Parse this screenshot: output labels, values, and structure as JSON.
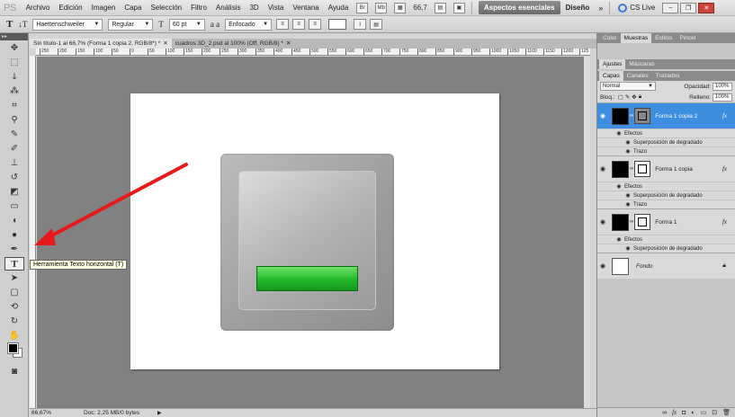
{
  "menubar": {
    "logo": "PS",
    "items": [
      "Archivo",
      "Edición",
      "Imagen",
      "Capa",
      "Selección",
      "Filtro",
      "Análisis",
      "3D",
      "Vista",
      "Ventana",
      "Ayuda"
    ],
    "br_label": "Br",
    "mb_label": "Mb",
    "zoom": "66,7",
    "workspace_active": "Aspectos esenciales",
    "workspace_design": "Diseño",
    "more": "»",
    "cslive": "CS Live"
  },
  "options": {
    "tool_glyph": "T",
    "orient_glyph": "↓T",
    "font_family": "Haettenschweiler",
    "font_style": "Regular",
    "size_glyph": "T",
    "font_size": "60 pt",
    "aa_glyph": "a a",
    "antialias": "Enfocado"
  },
  "tooltip": "Herramienta Texto horizontal (T)",
  "doc_tabs": [
    {
      "label": "Sin título-1 al 66,7% (Forma 1 copia 2, RGB/8*) *",
      "active": true
    },
    {
      "label": "cuadros 3D_2.psd al 100% (Off, RGB/8) *",
      "active": false
    }
  ],
  "ruler_ticks": [
    "250",
    "200",
    "150",
    "100",
    "50",
    "0",
    "50",
    "100",
    "150",
    "200",
    "250",
    "300",
    "350",
    "400",
    "450",
    "500",
    "550",
    "600",
    "650",
    "700",
    "750",
    "800",
    "850",
    "900",
    "950",
    "1000",
    "1050",
    "1100",
    "1150",
    "1200",
    "125"
  ],
  "status": {
    "zoom": "66,67%",
    "doc": "Doc: 2,25 MB/0 bytes"
  },
  "panels": {
    "top_tabs": [
      "Color",
      "Muestras",
      "Estilos",
      "Pincel"
    ],
    "top_active": "Muestras",
    "adj_tabs": [
      "Ajustes",
      "Máscaras"
    ],
    "adj_active": "Ajustes",
    "layer_tabs": [
      "Capas",
      "Canales",
      "Trazados"
    ],
    "layer_active": "Capas",
    "blend_mode": "Normal",
    "opacity_label": "Opacidad:",
    "opacity": "100%",
    "lock_label": "Bloq.:",
    "fill_label": "Relleno:",
    "fill": "100%"
  },
  "layers": [
    {
      "name": "Forma 1 copia 2",
      "selected": true,
      "effects_label": "Efectos",
      "effects": [
        "Superposición de degradado",
        "Trazo"
      ]
    },
    {
      "name": "Forma 1 copia",
      "selected": false,
      "effects_label": "Efectos",
      "effects": [
        "Superposición de degradado",
        "Trazo"
      ]
    },
    {
      "name": "Forma 1",
      "selected": false,
      "effects_label": "Efectos",
      "effects": [
        "Superposición de degradado"
      ]
    }
  ],
  "background_layer": "Fondo",
  "fx_label": "fx",
  "colors": {
    "selected_layer": "#3d8ee0",
    "arrow": "#e8191b",
    "green_bar": "#22b82b",
    "canvas_bg": "#818181"
  }
}
